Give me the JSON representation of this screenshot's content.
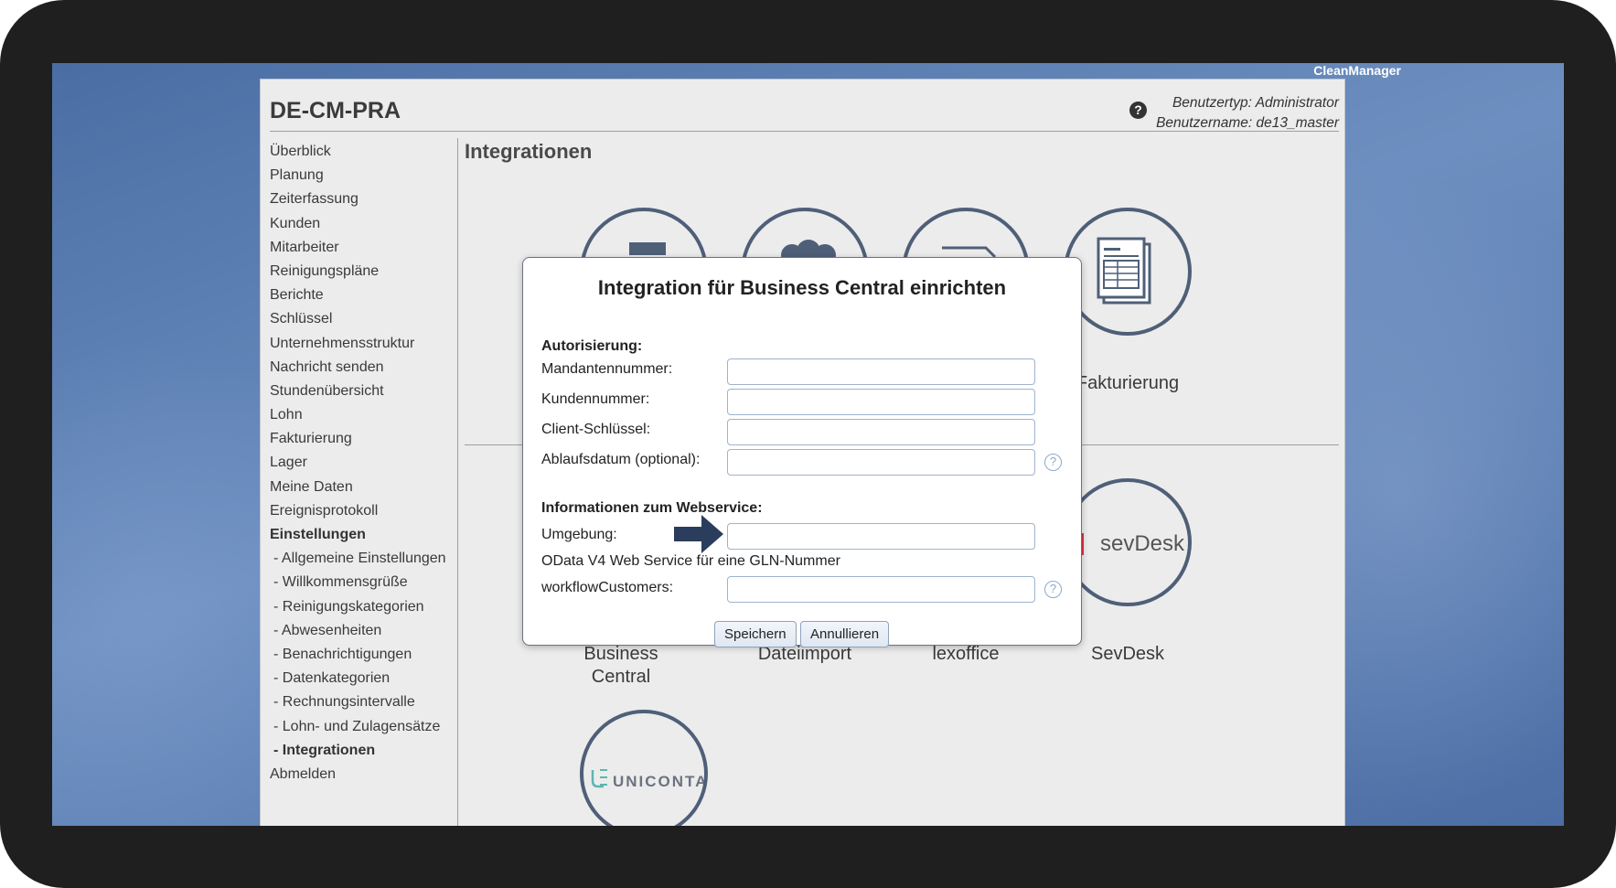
{
  "brand": "CleanManager",
  "app": {
    "title": "DE-CM-PRA",
    "user_type": "Benutzertyp: Administrator",
    "user_name": "Benutzername: de13_master",
    "help_glyph": "?"
  },
  "sidebar": {
    "items": [
      {
        "label": "Überblick"
      },
      {
        "label": "Planung"
      },
      {
        "label": "Zeiterfassung"
      },
      {
        "label": "Kunden"
      },
      {
        "label": "Mitarbeiter"
      },
      {
        "label": "Reinigungspläne"
      },
      {
        "label": "Berichte"
      },
      {
        "label": "Schlüssel"
      },
      {
        "label": "Unternehmensstruktur"
      },
      {
        "label": "Nachricht senden"
      },
      {
        "label": "Stundenübersicht"
      },
      {
        "label": "Lohn"
      },
      {
        "label": "Fakturierung"
      },
      {
        "label": "Lager"
      },
      {
        "label": "Meine Daten"
      },
      {
        "label": "Ereignisprotokoll"
      },
      {
        "label": "Einstellungen"
      },
      {
        "label": "- Allgemeine Einstellungen"
      },
      {
        "label": "- Willkommensgrüße"
      },
      {
        "label": "- Reinigungskategorien"
      },
      {
        "label": "- Abwesenheiten"
      },
      {
        "label": "- Benachrichtigungen"
      },
      {
        "label": "- Datenkategorien"
      },
      {
        "label": "- Rechnungsintervalle"
      },
      {
        "label": "- Lohn- und Zulagensätze"
      },
      {
        "label": "- Integrationen"
      },
      {
        "label": "Abmelden"
      }
    ]
  },
  "main": {
    "title": "Integrationen",
    "tiles": {
      "fakturierung": "Fakturierung",
      "business_central_1": "Business",
      "business_central_2": "Central",
      "dateiimport": "Dateiimport",
      "lexoffice": "lexoffice",
      "sevdesk": "SevDesk",
      "sevdesk_logo": "sevDesk",
      "uniconta_logo": "UNICONTA"
    }
  },
  "modal": {
    "title": "Integration für Business Central einrichten",
    "section_auth": "Autorisierung:",
    "label_mandant": "Mandantennummer:",
    "label_kunden": "Kundennummer:",
    "label_client": "Client-Schlüssel:",
    "label_ablauf": "Ablaufsdatum (optional):",
    "section_ws": "Informationen zum Webservice:",
    "label_umgebung": "Umgebung:",
    "odata_note": "OData V4 Web Service für eine GLN-Nummer",
    "label_workflow": "workflowCustomers:",
    "values": {
      "mandant": "",
      "kunden": "",
      "client": "",
      "ablauf": "",
      "umgebung": "",
      "workflow": ""
    },
    "save": "Speichern",
    "cancel": "Annullieren",
    "help_glyph": "?"
  },
  "colors": {
    "desktop": "#5a7cb0",
    "tile_border": "#4f5f78",
    "arrow": "#2b3d5c",
    "sevdesk_red": "#d9363e",
    "uniconta_teal": "#5bb7b0"
  }
}
